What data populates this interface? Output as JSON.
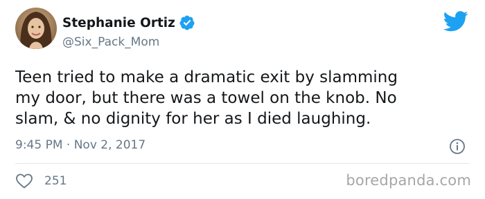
{
  "author": {
    "name": "Stephanie Ortiz",
    "handle": "@Six_Pack_Mom",
    "verified": true,
    "avatar_icon": "profile-photo"
  },
  "tweet": {
    "lines": [
      "Teen tried to make a dramatic exit by slamming",
      "my door, but there was a towel on the knob. No",
      "slam, & no dignity for her as I died laughing."
    ],
    "timestamp": "9:45 PM · Nov 2, 2017"
  },
  "engagement": {
    "likes": "251"
  },
  "icons": {
    "brand": "twitter-bird-icon",
    "verified": "verified-badge-icon",
    "info": "info-icon",
    "like": "heart-icon"
  },
  "colors": {
    "twitter_blue": "#1da1f2",
    "text_primary": "#14171a",
    "text_secondary": "#657786",
    "divider": "#e1e8ed"
  },
  "watermark": "boredpanda.com"
}
